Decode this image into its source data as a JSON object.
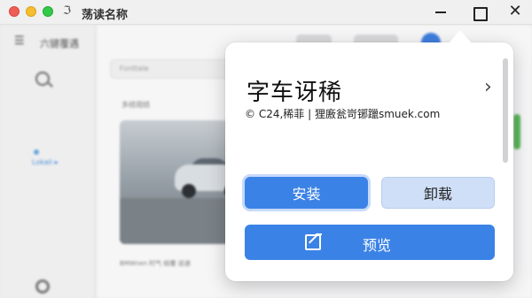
{
  "window": {
    "app_glyph": "ℑ",
    "title": "荡读名称",
    "close_symbol": "✕"
  },
  "background": {
    "sidebar_menu_symbol": "☰",
    "sidebar_title": "六键覆遇",
    "sidebar_item": "Lokali ▸",
    "search_placeholder": "Fonttale",
    "section_label": "多结观结",
    "thumb_caption": "BMWnen 时气 结覆 说通"
  },
  "popover": {
    "title": "字车讶稀",
    "chevron": "›",
    "meta": "© C24,稀菲 | 狸廒瓮岢铘躐smuek.com",
    "install_label": "安装",
    "uninstall_label": "卸载",
    "preview_label": "预览"
  },
  "colors": {
    "primary": "#3b82e6",
    "secondary": "#cfdff7"
  }
}
